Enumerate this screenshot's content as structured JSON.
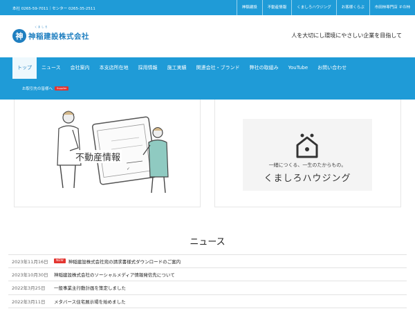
{
  "topbar": {
    "phones": "本社 0265-59-7011｜センター 0265-35-2511",
    "links": [
      "神稲建設",
      "不動産情報",
      "くましろハウジング",
      "お客様くらぶ",
      "市田柿専門店 ＃の柿"
    ]
  },
  "header": {
    "logo_ruby": "くましろ",
    "logo_mark": "神",
    "logo_text": "神稲建設株式会社",
    "tagline": "人を大切にし環境にやさしい企業を目指して"
  },
  "nav": {
    "items": [
      "トップ",
      "ニュース",
      "会社案内",
      "本支店所在地",
      "採用情報",
      "施工実績",
      "関連会社・ブランド",
      "弊社の取組み",
      "YouTube",
      "お問い合わせ"
    ],
    "active_index": 0,
    "sub_label": "お取引先の皆様へ",
    "sub_badge": "Supplier"
  },
  "banners": {
    "real_estate": {
      "title": "不動産情報"
    },
    "housing": {
      "tagline": "一緒につくる、一生のたからもの。",
      "name": "くましろハウジング"
    }
  },
  "news": {
    "title": "ニュース",
    "new_badge": "NEW",
    "items": [
      {
        "date": "2023年11月16日",
        "is_new": true,
        "text": "神稲建設株式会社宛の請求書様式ダウンロードのご案内"
      },
      {
        "date": "2023年10月30日",
        "is_new": false,
        "text": "神稲建設株式会社のソーシャルメディア情報発信先について"
      },
      {
        "date": "2022年3月25日",
        "is_new": false,
        "text": "一般事業主行動計画を策定しました"
      },
      {
        "date": "2022年3月11日",
        "is_new": false,
        "text": "メタバース住宅展示場を始めました"
      }
    ]
  },
  "colors": {
    "brand_blue": "#1f9bd7",
    "logo_blue": "#1f7fc0",
    "badge_red": "#e3342f"
  }
}
